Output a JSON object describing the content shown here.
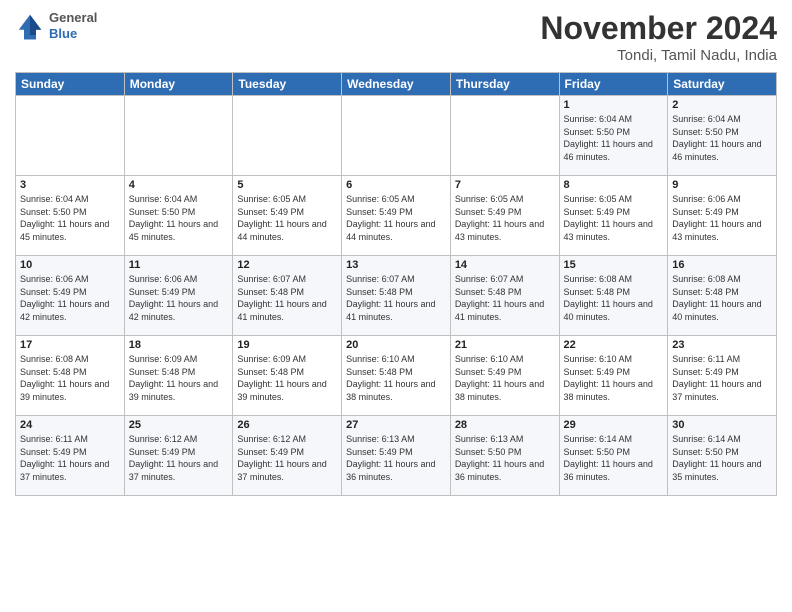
{
  "header": {
    "logo_general": "General",
    "logo_blue": "Blue",
    "month_title": "November 2024",
    "location": "Tondi, Tamil Nadu, India"
  },
  "calendar": {
    "days_of_week": [
      "Sunday",
      "Monday",
      "Tuesday",
      "Wednesday",
      "Thursday",
      "Friday",
      "Saturday"
    ],
    "weeks": [
      [
        {
          "day": "",
          "info": ""
        },
        {
          "day": "",
          "info": ""
        },
        {
          "day": "",
          "info": ""
        },
        {
          "day": "",
          "info": ""
        },
        {
          "day": "",
          "info": ""
        },
        {
          "day": "1",
          "info": "Sunrise: 6:04 AM\nSunset: 5:50 PM\nDaylight: 11 hours and 46 minutes."
        },
        {
          "day": "2",
          "info": "Sunrise: 6:04 AM\nSunset: 5:50 PM\nDaylight: 11 hours and 46 minutes."
        }
      ],
      [
        {
          "day": "3",
          "info": "Sunrise: 6:04 AM\nSunset: 5:50 PM\nDaylight: 11 hours and 45 minutes."
        },
        {
          "day": "4",
          "info": "Sunrise: 6:04 AM\nSunset: 5:50 PM\nDaylight: 11 hours and 45 minutes."
        },
        {
          "day": "5",
          "info": "Sunrise: 6:05 AM\nSunset: 5:49 PM\nDaylight: 11 hours and 44 minutes."
        },
        {
          "day": "6",
          "info": "Sunrise: 6:05 AM\nSunset: 5:49 PM\nDaylight: 11 hours and 44 minutes."
        },
        {
          "day": "7",
          "info": "Sunrise: 6:05 AM\nSunset: 5:49 PM\nDaylight: 11 hours and 43 minutes."
        },
        {
          "day": "8",
          "info": "Sunrise: 6:05 AM\nSunset: 5:49 PM\nDaylight: 11 hours and 43 minutes."
        },
        {
          "day": "9",
          "info": "Sunrise: 6:06 AM\nSunset: 5:49 PM\nDaylight: 11 hours and 43 minutes."
        }
      ],
      [
        {
          "day": "10",
          "info": "Sunrise: 6:06 AM\nSunset: 5:49 PM\nDaylight: 11 hours and 42 minutes."
        },
        {
          "day": "11",
          "info": "Sunrise: 6:06 AM\nSunset: 5:49 PM\nDaylight: 11 hours and 42 minutes."
        },
        {
          "day": "12",
          "info": "Sunrise: 6:07 AM\nSunset: 5:48 PM\nDaylight: 11 hours and 41 minutes."
        },
        {
          "day": "13",
          "info": "Sunrise: 6:07 AM\nSunset: 5:48 PM\nDaylight: 11 hours and 41 minutes."
        },
        {
          "day": "14",
          "info": "Sunrise: 6:07 AM\nSunset: 5:48 PM\nDaylight: 11 hours and 41 minutes."
        },
        {
          "day": "15",
          "info": "Sunrise: 6:08 AM\nSunset: 5:48 PM\nDaylight: 11 hours and 40 minutes."
        },
        {
          "day": "16",
          "info": "Sunrise: 6:08 AM\nSunset: 5:48 PM\nDaylight: 11 hours and 40 minutes."
        }
      ],
      [
        {
          "day": "17",
          "info": "Sunrise: 6:08 AM\nSunset: 5:48 PM\nDaylight: 11 hours and 39 minutes."
        },
        {
          "day": "18",
          "info": "Sunrise: 6:09 AM\nSunset: 5:48 PM\nDaylight: 11 hours and 39 minutes."
        },
        {
          "day": "19",
          "info": "Sunrise: 6:09 AM\nSunset: 5:48 PM\nDaylight: 11 hours and 39 minutes."
        },
        {
          "day": "20",
          "info": "Sunrise: 6:10 AM\nSunset: 5:48 PM\nDaylight: 11 hours and 38 minutes."
        },
        {
          "day": "21",
          "info": "Sunrise: 6:10 AM\nSunset: 5:49 PM\nDaylight: 11 hours and 38 minutes."
        },
        {
          "day": "22",
          "info": "Sunrise: 6:10 AM\nSunset: 5:49 PM\nDaylight: 11 hours and 38 minutes."
        },
        {
          "day": "23",
          "info": "Sunrise: 6:11 AM\nSunset: 5:49 PM\nDaylight: 11 hours and 37 minutes."
        }
      ],
      [
        {
          "day": "24",
          "info": "Sunrise: 6:11 AM\nSunset: 5:49 PM\nDaylight: 11 hours and 37 minutes."
        },
        {
          "day": "25",
          "info": "Sunrise: 6:12 AM\nSunset: 5:49 PM\nDaylight: 11 hours and 37 minutes."
        },
        {
          "day": "26",
          "info": "Sunrise: 6:12 AM\nSunset: 5:49 PM\nDaylight: 11 hours and 37 minutes."
        },
        {
          "day": "27",
          "info": "Sunrise: 6:13 AM\nSunset: 5:49 PM\nDaylight: 11 hours and 36 minutes."
        },
        {
          "day": "28",
          "info": "Sunrise: 6:13 AM\nSunset: 5:50 PM\nDaylight: 11 hours and 36 minutes."
        },
        {
          "day": "29",
          "info": "Sunrise: 6:14 AM\nSunset: 5:50 PM\nDaylight: 11 hours and 36 minutes."
        },
        {
          "day": "30",
          "info": "Sunrise: 6:14 AM\nSunset: 5:50 PM\nDaylight: 11 hours and 35 minutes."
        }
      ]
    ]
  }
}
